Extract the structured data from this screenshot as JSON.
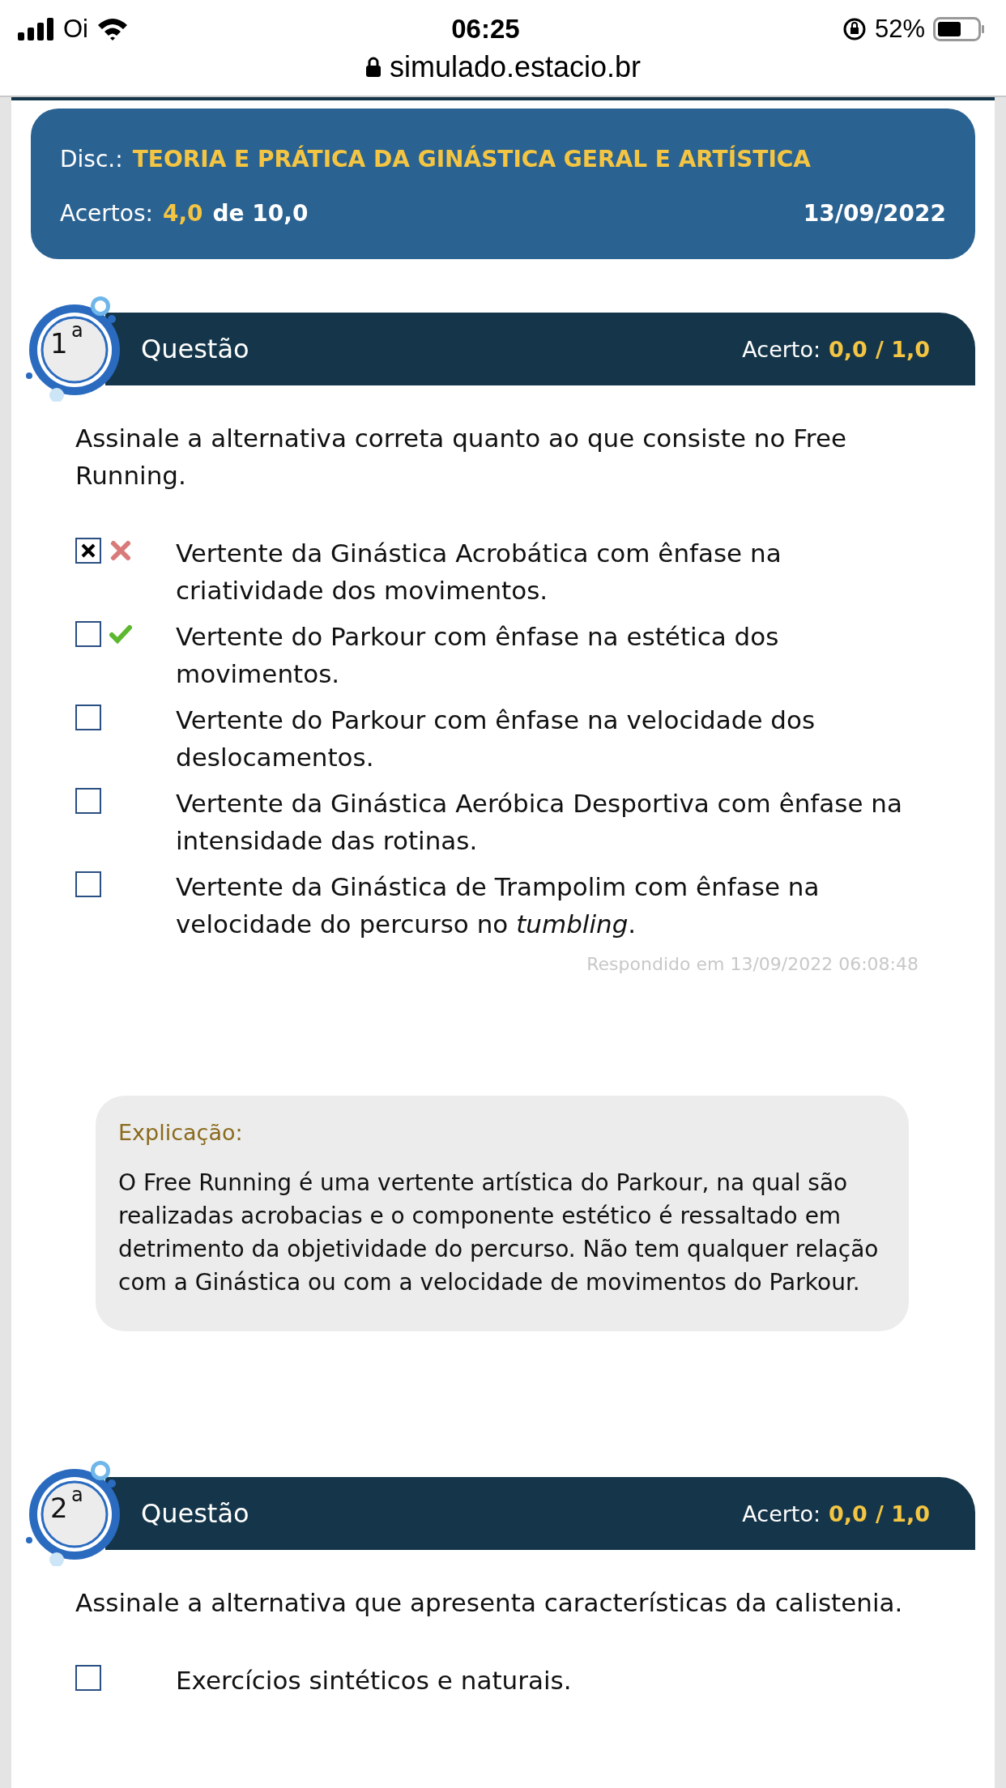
{
  "status_bar": {
    "carrier": "Oi",
    "time": "06:25",
    "battery": "52%"
  },
  "url": "simulado.estacio.br",
  "summary": {
    "disc_label": "Disc.:",
    "discipline": "TEORIA E PRÁTICA DA GINÁSTICA GERAL E ARTÍSTICA",
    "score_label": "Acertos:",
    "score": "4,0",
    "score_total": "de 10,0",
    "date": "13/09/2022"
  },
  "questions": [
    {
      "number": "1",
      "ordinal": "a",
      "title": "Questão",
      "score_label": "Acerto:",
      "score": "0,0",
      "score_total": "/ 1,0",
      "text": "Assinale a alternativa correta quanto ao que consiste no Free Running.",
      "options": [
        {
          "text": "Vertente da Ginástica Acrobática com ênfase na criatividade dos movimentos.",
          "checked": true,
          "kind": "wrong"
        },
        {
          "text": "Vertente do Parkour com ênfase na estética dos movimentos.",
          "checked": false,
          "kind": "correct"
        },
        {
          "text": "Vertente do Parkour com ênfase na velocidade dos deslocamentos.",
          "checked": false,
          "kind": "plain"
        },
        {
          "text": "Vertente da Ginástica Aeróbica Desportiva com ênfase na intensidade das rotinas.",
          "checked": false,
          "kind": "plain"
        },
        {
          "text": "Vertente da Ginástica de Trampolim com ênfase na velocidade do percurso no *tumbling*.",
          "checked": false,
          "kind": "plain"
        }
      ],
      "answered": "Respondido em 13/09/2022 06:08:48",
      "explanation": {
        "title": "Explicação:",
        "text": "O Free Running é uma vertente artística do Parkour, na qual são realizadas acrobacias e o componente estético é ressaltado em detrimento da objetividade do percurso. Não tem qualquer relação com a Ginástica ou com a velocidade de movimentos do Parkour."
      }
    },
    {
      "number": "2",
      "ordinal": "a",
      "title": "Questão",
      "score_label": "Acerto:",
      "score": "0,0",
      "score_total": "/ 1,0",
      "text": "Assinale a alternativa que apresenta características da calistenia.",
      "options": [
        {
          "text": "Exercícios sintéticos e naturais.",
          "checked": false,
          "kind": "plain"
        }
      ]
    }
  ]
}
